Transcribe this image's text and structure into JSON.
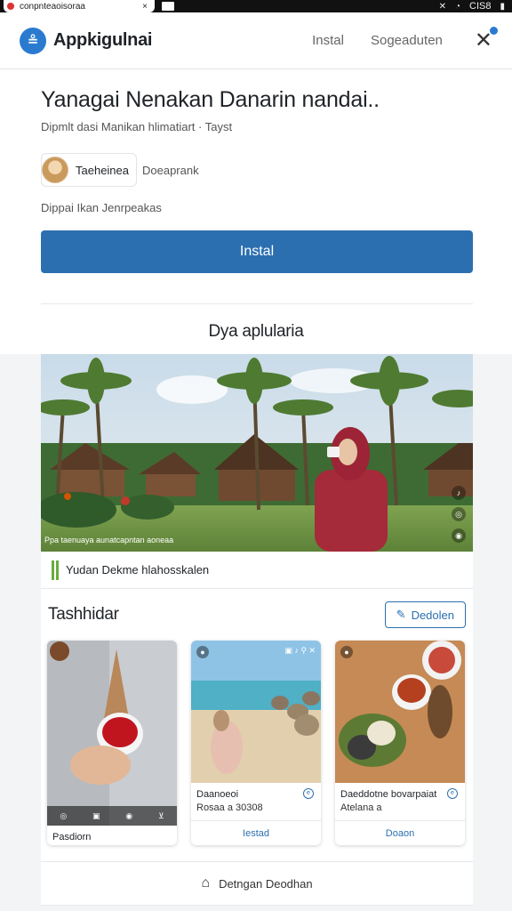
{
  "browser": {
    "tab_url": "conpnteaoisoraa",
    "tab_close": "×",
    "battery": "CIS8"
  },
  "header": {
    "logo_glyph": "≗",
    "brand": "Appkigulnai",
    "nav": [
      "Instal",
      "Sogeaduten"
    ],
    "close_glyph": "✕"
  },
  "hero": {
    "title": "Yanagai Nenakan Danarin nandai..",
    "subtitle": "Dipmlt dasi Manikan hlimatiart · Tayst",
    "author_name": "Taeheinea",
    "author_role": "Doeaprank",
    "note": "Dippai Ikan Jenrpeakas",
    "install_label": "Instal",
    "section_title": "Dya aplularia"
  },
  "feature": {
    "caption_overlay": "Ppa taenuaya aunatcapntan aoneaa",
    "caption": "Yudan Dekme hlahosskalen",
    "side_icons": [
      "♪",
      "◎",
      "◉"
    ]
  },
  "gallery": {
    "title": "Tashhidar",
    "button_label": "Dedolen",
    "cards": [
      {
        "title": "Pasdiorn",
        "sub": "",
        "action": ""
      },
      {
        "title": "Daanoeoi",
        "sub": "Rosaa a 30308",
        "action": "Iestad"
      },
      {
        "title": "Daeddotne bovarpaiat",
        "sub": "Atelana a",
        "action": "Doaon"
      }
    ]
  },
  "footer": {
    "label": "Detngan Deodhan"
  },
  "colors": {
    "accent": "#2b6fb0",
    "logo": "#2a7bd0",
    "caption_bar": "#6bab3f"
  }
}
